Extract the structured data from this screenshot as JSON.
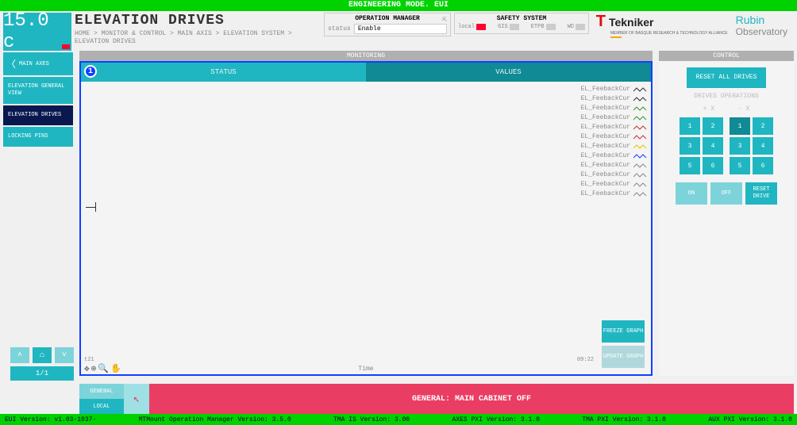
{
  "topbar": "ENGINEERING MODE. EUI",
  "temperature": "15.0 c",
  "title": "ELEVATION DRIVES",
  "breadcrumb": "HOME > MONITOR & CONTROL > MAIN AXIS > ELEVATION SYSTEM > ELEVATION DRIVES",
  "op_mgr": {
    "title": "OPERATION MANAGER",
    "status_lbl": "status",
    "status_val": "Enable"
  },
  "safety": {
    "title": "SAFETY SYSTEM",
    "items": [
      {
        "lbl": "local",
        "red": true
      },
      {
        "lbl": "GIS",
        "red": false
      },
      {
        "lbl": "ETPB",
        "red": false
      },
      {
        "lbl": "WD",
        "red": false
      }
    ]
  },
  "logos": {
    "tekniker": "Tekniker",
    "tekniker_sub": "MEMBER OF BASQUE RESEARCH & TECHNOLOGY ALLIANCE",
    "rubin1": "Rubin",
    "rubin2": "Observatory"
  },
  "sidebar": {
    "back": "MAIN AXES",
    "items": [
      {
        "label": "ELEVATION GENERAL VIEW",
        "active": false
      },
      {
        "label": "ELEVATION DRIVES",
        "active": true
      },
      {
        "label": "LOCKING PINS",
        "active": false
      }
    ]
  },
  "monitoring": {
    "title": "MONITORING",
    "tabs": {
      "status": "STATUS",
      "values": "VALUES",
      "badge": "1"
    },
    "legend": [
      "EL_FeebackCur",
      "EL_FeebackCur",
      "EL_FeebackCur",
      "EL_FeebackCur",
      "EL_FeebackCur",
      "EL_FeebackCur",
      "EL_FeebackCur",
      "EL_FeebackCur",
      "EL_FeebackCur",
      "EL_FeebackCur",
      "EL_FeebackCur",
      "EL_FeebackCur"
    ],
    "legend_colors": [
      "#333",
      "#333",
      "#2a9d2a",
      "#2a9d2a",
      "#c33",
      "#c33",
      "#e6c300",
      "#1040ff",
      "#888",
      "#888",
      "#888",
      "#888"
    ],
    "xlabel": "Time",
    "xt_left": "t21",
    "xt_right": "09:22",
    "freeze": "FREEZE GRAPH",
    "update": "UPDATE GRAPH"
  },
  "control": {
    "title": "CONTROL",
    "reset_all": "RESET ALL DRIVES",
    "ops_lbl": "DRIVES OPERATIONS",
    "x_hdr": "+ X",
    "mx_hdr": "- X",
    "grid_x": [
      [
        "1",
        "2"
      ],
      [
        "3",
        "4"
      ],
      [
        "5",
        "6"
      ]
    ],
    "grid_mx": [
      [
        "1",
        "2"
      ],
      [
        "3",
        "4"
      ],
      [
        "5",
        "6"
      ]
    ],
    "selected": "mx-0-0",
    "on": "ON",
    "off": "OFF",
    "reset_drive": "RESET DRIVE"
  },
  "nav": {
    "page": "1/1"
  },
  "alarm": {
    "gen": "GENERAL",
    "loc": "LOCAL",
    "msg": "GENERAL: MAIN CABINET OFF"
  },
  "statusbar": {
    "eui": "EUI Version: v1.03-1037-",
    "mtm": "MTMount Operation Manager Version: 3.5.0",
    "tmais": "TMA IS Version: 3.00",
    "axes": "AXES PXI Version: 3.1.0",
    "tmapxi": "TMA PXI Version: 3.1.0",
    "aux": "AUX PXI Version: 3.1.0"
  }
}
